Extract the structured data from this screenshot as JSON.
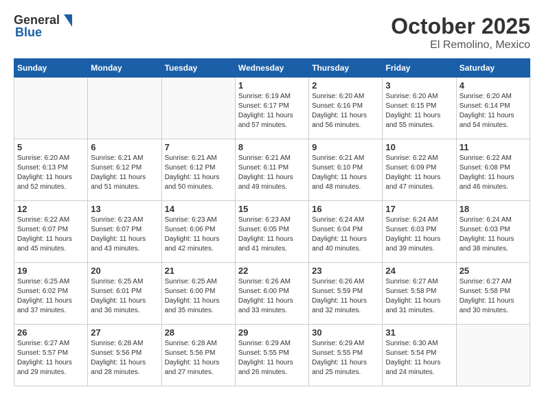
{
  "header": {
    "logo_general": "General",
    "logo_blue": "Blue",
    "month": "October 2025",
    "location": "El Remolino, Mexico"
  },
  "days_of_week": [
    "Sunday",
    "Monday",
    "Tuesday",
    "Wednesday",
    "Thursday",
    "Friday",
    "Saturday"
  ],
  "weeks": [
    [
      {
        "day": "",
        "info": ""
      },
      {
        "day": "",
        "info": ""
      },
      {
        "day": "",
        "info": ""
      },
      {
        "day": "1",
        "info": "Sunrise: 6:19 AM\nSunset: 6:17 PM\nDaylight: 11 hours\nand 57 minutes."
      },
      {
        "day": "2",
        "info": "Sunrise: 6:20 AM\nSunset: 6:16 PM\nDaylight: 11 hours\nand 56 minutes."
      },
      {
        "day": "3",
        "info": "Sunrise: 6:20 AM\nSunset: 6:15 PM\nDaylight: 11 hours\nand 55 minutes."
      },
      {
        "day": "4",
        "info": "Sunrise: 6:20 AM\nSunset: 6:14 PM\nDaylight: 11 hours\nand 54 minutes."
      }
    ],
    [
      {
        "day": "5",
        "info": "Sunrise: 6:20 AM\nSunset: 6:13 PM\nDaylight: 11 hours\nand 52 minutes."
      },
      {
        "day": "6",
        "info": "Sunrise: 6:21 AM\nSunset: 6:12 PM\nDaylight: 11 hours\nand 51 minutes."
      },
      {
        "day": "7",
        "info": "Sunrise: 6:21 AM\nSunset: 6:12 PM\nDaylight: 11 hours\nand 50 minutes."
      },
      {
        "day": "8",
        "info": "Sunrise: 6:21 AM\nSunset: 6:11 PM\nDaylight: 11 hours\nand 49 minutes."
      },
      {
        "day": "9",
        "info": "Sunrise: 6:21 AM\nSunset: 6:10 PM\nDaylight: 11 hours\nand 48 minutes."
      },
      {
        "day": "10",
        "info": "Sunrise: 6:22 AM\nSunset: 6:09 PM\nDaylight: 11 hours\nand 47 minutes."
      },
      {
        "day": "11",
        "info": "Sunrise: 6:22 AM\nSunset: 6:08 PM\nDaylight: 11 hours\nand 46 minutes."
      }
    ],
    [
      {
        "day": "12",
        "info": "Sunrise: 6:22 AM\nSunset: 6:07 PM\nDaylight: 11 hours\nand 45 minutes."
      },
      {
        "day": "13",
        "info": "Sunrise: 6:23 AM\nSunset: 6:07 PM\nDaylight: 11 hours\nand 43 minutes."
      },
      {
        "day": "14",
        "info": "Sunrise: 6:23 AM\nSunset: 6:06 PM\nDaylight: 11 hours\nand 42 minutes."
      },
      {
        "day": "15",
        "info": "Sunrise: 6:23 AM\nSunset: 6:05 PM\nDaylight: 11 hours\nand 41 minutes."
      },
      {
        "day": "16",
        "info": "Sunrise: 6:24 AM\nSunset: 6:04 PM\nDaylight: 11 hours\nand 40 minutes."
      },
      {
        "day": "17",
        "info": "Sunrise: 6:24 AM\nSunset: 6:03 PM\nDaylight: 11 hours\nand 39 minutes."
      },
      {
        "day": "18",
        "info": "Sunrise: 6:24 AM\nSunset: 6:03 PM\nDaylight: 11 hours\nand 38 minutes."
      }
    ],
    [
      {
        "day": "19",
        "info": "Sunrise: 6:25 AM\nSunset: 6:02 PM\nDaylight: 11 hours\nand 37 minutes."
      },
      {
        "day": "20",
        "info": "Sunrise: 6:25 AM\nSunset: 6:01 PM\nDaylight: 11 hours\nand 36 minutes."
      },
      {
        "day": "21",
        "info": "Sunrise: 6:25 AM\nSunset: 6:00 PM\nDaylight: 11 hours\nand 35 minutes."
      },
      {
        "day": "22",
        "info": "Sunrise: 6:26 AM\nSunset: 6:00 PM\nDaylight: 11 hours\nand 33 minutes."
      },
      {
        "day": "23",
        "info": "Sunrise: 6:26 AM\nSunset: 5:59 PM\nDaylight: 11 hours\nand 32 minutes."
      },
      {
        "day": "24",
        "info": "Sunrise: 6:27 AM\nSunset: 5:58 PM\nDaylight: 11 hours\nand 31 minutes."
      },
      {
        "day": "25",
        "info": "Sunrise: 6:27 AM\nSunset: 5:58 PM\nDaylight: 11 hours\nand 30 minutes."
      }
    ],
    [
      {
        "day": "26",
        "info": "Sunrise: 6:27 AM\nSunset: 5:57 PM\nDaylight: 11 hours\nand 29 minutes."
      },
      {
        "day": "27",
        "info": "Sunrise: 6:28 AM\nSunset: 5:56 PM\nDaylight: 11 hours\nand 28 minutes."
      },
      {
        "day": "28",
        "info": "Sunrise: 6:28 AM\nSunset: 5:56 PM\nDaylight: 11 hours\nand 27 minutes."
      },
      {
        "day": "29",
        "info": "Sunrise: 6:29 AM\nSunset: 5:55 PM\nDaylight: 11 hours\nand 26 minutes."
      },
      {
        "day": "30",
        "info": "Sunrise: 6:29 AM\nSunset: 5:55 PM\nDaylight: 11 hours\nand 25 minutes."
      },
      {
        "day": "31",
        "info": "Sunrise: 6:30 AM\nSunset: 5:54 PM\nDaylight: 11 hours\nand 24 minutes."
      },
      {
        "day": "",
        "info": ""
      }
    ]
  ]
}
